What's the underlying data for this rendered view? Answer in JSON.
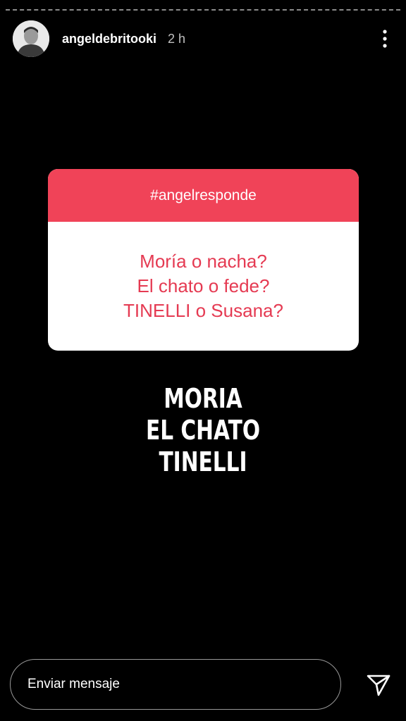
{
  "header": {
    "username": "angeldebritooki",
    "time": "2 h",
    "avatar_icon": "profile-photo",
    "more_icon": "vertical-ellipsis-icon"
  },
  "question_sticker": {
    "hashtag": "#angelresponde",
    "lines": [
      "Moría o nacha?",
      "El chato o fede?",
      "TINELLI o Susana?"
    ],
    "header_color": "#f04358",
    "text_color": "#e53a52"
  },
  "answer": {
    "lines": [
      "MORIA",
      "EL CHATO",
      "TINELLI"
    ]
  },
  "reply": {
    "placeholder": "Enviar mensaje",
    "send_icon": "paper-plane-icon"
  }
}
